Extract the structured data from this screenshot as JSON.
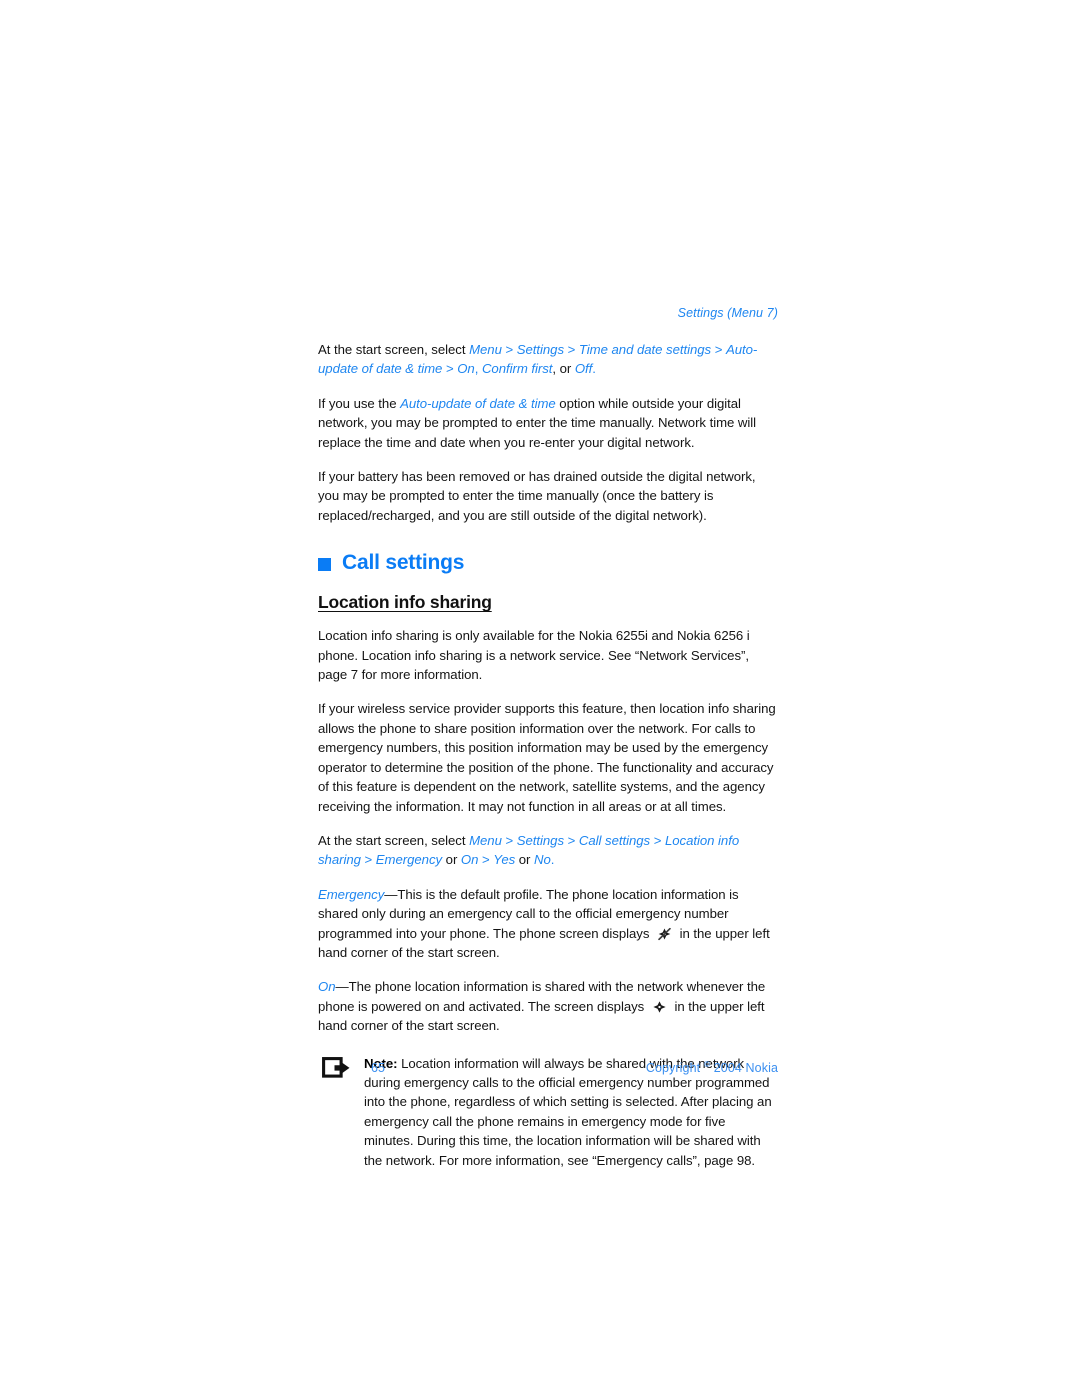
{
  "document": {
    "running_header": "Settings (Menu 7)",
    "page_number": "65",
    "copyright_pre": "Copyright ",
    "copyright_symbol": "©",
    "copyright_post": " 2004 Nokia",
    "accent_blue": "#0a7cf5",
    "link_blue": "#1e86f0",
    "body_color": "#141414"
  },
  "paragraphs": {
    "p1": {
      "s1": "At the start screen, select ",
      "t1": "Menu",
      "s2": " > ",
      "t2": "Settings",
      "s3": " > ",
      "t3": "Time and date settings",
      "s4": " > ",
      "t4": "Auto-update of date & time",
      "s5": " > ",
      "t5": "On",
      "s6": ", ",
      "t6": "Confirm first",
      "s7": ", or ",
      "t7": "Off",
      "s8": "."
    },
    "p2": {
      "s1": "If you use the ",
      "t1": "Auto-update of date & time",
      "s2": " option while outside your digital network, you may be prompted to enter the time manually. Network time will replace the time and date when you re-enter your digital network."
    },
    "p3": {
      "text": "If your battery has been removed or has drained outside the digital network, you may be prompted to enter the time manually (once the battery is replaced/recharged, and you are still outside of the digital network)."
    }
  },
  "section": {
    "heading": "Call settings",
    "bullet_icon": "blue-square-bullet"
  },
  "subsection": {
    "heading": "Location info sharing",
    "p1": {
      "text": "Location info sharing is only available for the Nokia 6255i and Nokia 6256 i phone. Location info sharing is a network service. See “Network Services”, page 7 for more information."
    },
    "p2": {
      "text": "If your wireless service provider supports this feature, then location info sharing allows the phone to share position information over the network. For calls to emergency numbers, this position information may be used by the emergency operator to determine the position of the phone. The functionality and accuracy of this feature is dependent on the network, satellite systems, and the agency receiving the information. It may not function in all areas or at all times."
    },
    "p3": {
      "s1": "At the start screen, select ",
      "t1": "Menu",
      "s2": " > ",
      "t2": "Settings",
      "s3": " > ",
      "t3": "Call settings",
      "s4": " > ",
      "t4": "Location info sharing",
      "s5": " > ",
      "t5": "Emergency",
      "s6": " or ",
      "t6": "On",
      "s7": " > ",
      "t7": "Yes",
      "s8": " or ",
      "t8": "No",
      "s9": "."
    },
    "p4": {
      "t1": "Emergency",
      "s1": "—This is the default profile. The phone location information is shared only during an emergency call to the official emergency number programmed into your phone. The phone screen displays ",
      "icon": "location-sharing-emergency-icon",
      "s2": " in the upper left hand corner of the start screen."
    },
    "p5": {
      "t1": "On",
      "s1": "—The phone location information is shared with the network whenever the phone is powered on and activated. The screen displays ",
      "icon": "location-sharing-on-icon",
      "s2": " in the upper left hand corner of the start screen."
    }
  },
  "note": {
    "icon": "note-arrow-icon",
    "label": "Note:",
    "text": " Location information will always be shared with the network during emergency calls to the official emergency number programmed into the phone, regardless of which setting is selected. After placing an emergency call the phone remains in emergency mode for five minutes. During this time, the location information will be shared with the network. For more information, see “Emergency calls”, page 98."
  }
}
